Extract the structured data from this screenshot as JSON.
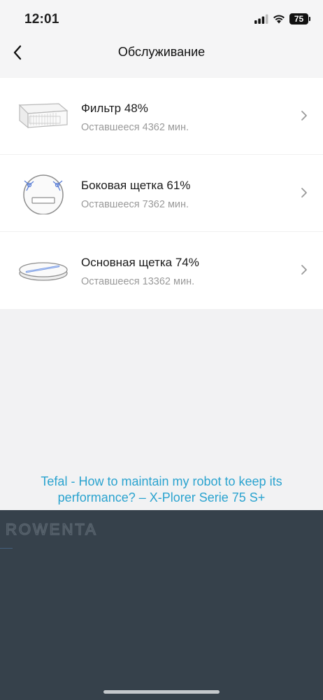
{
  "status_bar": {
    "time": "12:01",
    "battery": "75"
  },
  "nav": {
    "title": "Обслуживание"
  },
  "items": [
    {
      "title": "Фильтр 48%",
      "subtitle": "Оставшееся 4362 мин.",
      "icon": "filter-icon"
    },
    {
      "title": "Боковая щетка 61%",
      "subtitle": "Оставшееся 7362 мин.",
      "icon": "side-brush-icon"
    },
    {
      "title": "Основная щетка 74%",
      "subtitle": "Оставшееся 13362 мин.",
      "icon": "main-brush-icon"
    }
  ],
  "help_link": {
    "text": "Tefal - How to maintain my robot to keep its performance? – X-Plorer Serie 75 S+"
  },
  "footer": {
    "brand": "ROWENTA"
  },
  "colors": {
    "link": "#2aa3cf",
    "footer_bg": "#36414b",
    "page_bg": "#f2f2f3"
  }
}
